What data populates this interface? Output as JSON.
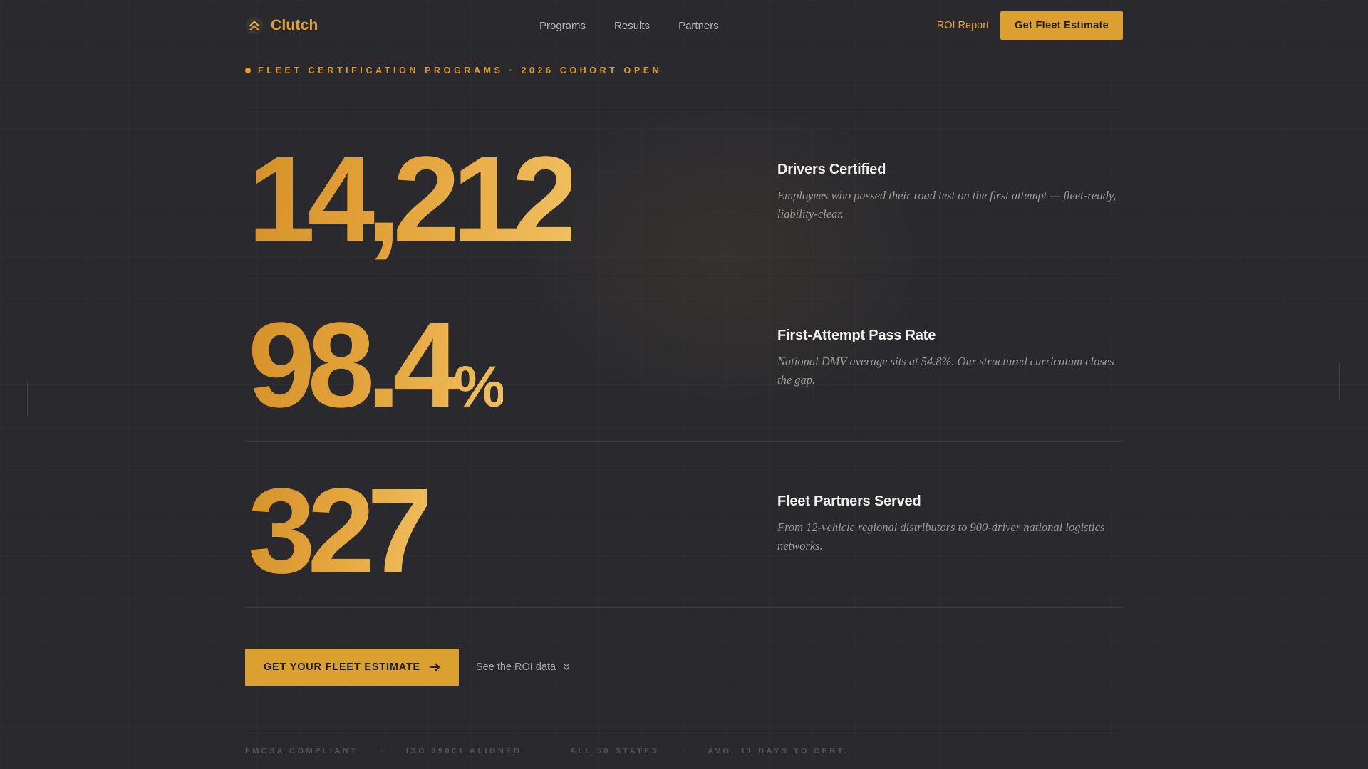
{
  "brand": {
    "name": "Clutch",
    "icon": "chevron-up-logo-icon"
  },
  "nav": {
    "links": [
      "Programs",
      "Results",
      "Partners"
    ],
    "roi_label": "ROI Report",
    "cta_label": "Get Fleet Estimate"
  },
  "eyebrow": "FLEET CERTIFICATION PROGRAMS · 2026 COHORT OPEN",
  "stats": [
    {
      "value": "14,212",
      "unit": "",
      "title": "Drivers Certified",
      "desc": "Employees who passed their road test on the first attempt — fleet-ready, liability-clear."
    },
    {
      "value": "98.4",
      "unit": "%",
      "title": "First-Attempt Pass Rate",
      "desc": "National DMV average sits at 54.8%. Our structured curriculum closes the gap."
    },
    {
      "value": "327",
      "unit": "",
      "title": "Fleet Partners Served",
      "desc": "From 12-vehicle regional distributors to 900-driver national logistics networks."
    }
  ],
  "cta": {
    "primary": "GET YOUR FLEET ESTIMATE",
    "secondary": "See the ROI data"
  },
  "trust": [
    "FMCSA COMPLIANT",
    "ISO 39001 ALIGNED",
    "ALL 50 STATES",
    "AVG. 11 DAYS TO CERT."
  ],
  "trust_separator": "·",
  "colors": {
    "accent": "#dca031",
    "background": "#2a2a2e",
    "text": "#f2f0ec",
    "muted": "#9d9a94"
  }
}
